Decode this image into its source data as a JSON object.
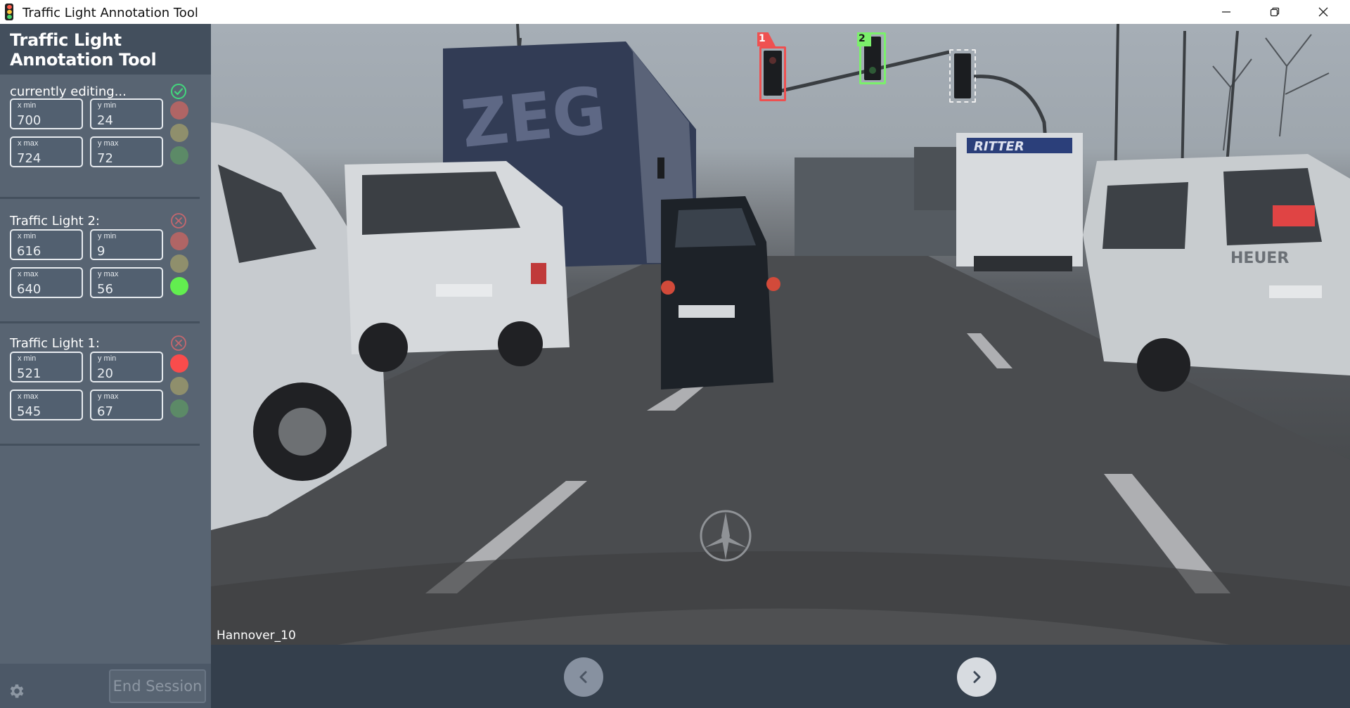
{
  "window": {
    "title": "Traffic Light Annotation Tool",
    "icon": "traffic-light-icon",
    "controls": [
      "minimize-icon",
      "restore-icon",
      "close-icon"
    ]
  },
  "sidebar": {
    "app_title": "Traffic Light Annotation Tool",
    "panels": [
      {
        "title": "currently editing...",
        "action_icon": "check-circle-icon",
        "x_min_label": "x min",
        "x_min": "700",
        "y_min_label": "y min",
        "y_min": "24",
        "x_max_label": "x max",
        "x_max": "724",
        "y_max_label": "y max",
        "y_max": "72",
        "active_light": "none"
      },
      {
        "title": "Traffic Light 2:",
        "action_icon": "delete-circle-icon",
        "x_min_label": "x min",
        "x_min": "616",
        "y_min_label": "y min",
        "y_min": "9",
        "x_max_label": "x max",
        "x_max": "640",
        "y_max_label": "y max",
        "y_max": "56",
        "active_light": "green"
      },
      {
        "title": "Traffic Light 1:",
        "action_icon": "delete-circle-icon",
        "x_min_label": "x min",
        "x_min": "521",
        "y_min_label": "y min",
        "y_min": "20",
        "x_max_label": "x max",
        "x_max": "545",
        "y_max_label": "y max",
        "y_max": "67",
        "active_light": "red"
      }
    ],
    "footer": {
      "settings_icon": "gear-icon",
      "end_session_label": "End Session"
    }
  },
  "viewport": {
    "image_caption": "Hannover_10",
    "annotations": [
      {
        "label": "1",
        "color": "#ef4f4f",
        "state": "red"
      },
      {
        "label": "2",
        "color": "#7bf06b",
        "state": "green"
      },
      {
        "label": "",
        "color": "#eeeeee",
        "state": "editing"
      }
    ]
  },
  "navigation": {
    "prev_icon": "chevron-left-icon",
    "next_icon": "chevron-right-icon"
  },
  "colors": {
    "light_red_on": "#f94c4c",
    "light_red_off": "#b06565",
    "light_yellow_off": "#8f8f6c",
    "light_green_on": "#62ee4f",
    "light_green_off": "#5c8a67"
  }
}
